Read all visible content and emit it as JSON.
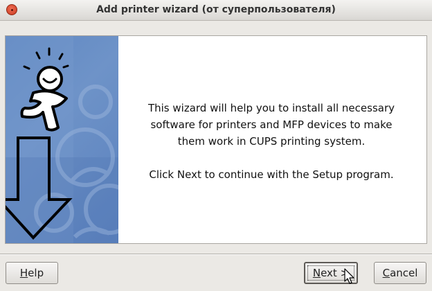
{
  "window": {
    "title": "Add printer wizard (от суперпользователя)"
  },
  "main": {
    "message_paragraphs": [
      "This wizard will help you to install all necessary software for printers and MFP devices to make them work in CUPS printing system.",
      "Click Next to continue with the Setup program."
    ]
  },
  "buttons": {
    "help": {
      "mnemonic": "H",
      "rest": "elp"
    },
    "next": {
      "mnemonic": "N",
      "rest": "ext >"
    },
    "cancel": {
      "mnemonic": "C",
      "rest": "ancel"
    }
  },
  "icons": {
    "close": "close-icon",
    "figure": "running-figure-icon",
    "arrow": "down-arrow-icon",
    "cursor": "mouse-pointer-icon"
  },
  "colors": {
    "side_panel_blue": "#6a8fc6",
    "close_red": "#d9472b"
  }
}
